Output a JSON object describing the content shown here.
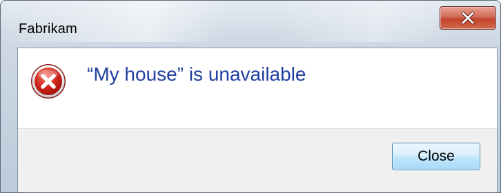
{
  "window": {
    "title": "Fabrikam",
    "close_icon": "close-x-icon"
  },
  "message": {
    "icon": "error-icon",
    "text": "“My house” is unavailable"
  },
  "footer": {
    "close_label": "Close"
  },
  "colors": {
    "message_text": "#1f3fa0",
    "close_x_button": "#c2452c",
    "button_border": "#3c7fb1",
    "error_icon_red": "#c81a1a"
  }
}
